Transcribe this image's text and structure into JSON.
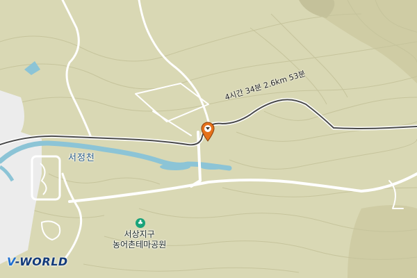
{
  "map": {
    "colors": {
      "land": "#d9d8b4",
      "contour": "#c6c49c",
      "water": "#8cc4d6",
      "road": "#ffffff",
      "route": "#4a4a4a",
      "urban": "#ececec",
      "pin": "#e5711b",
      "park_icon": "#1aa37a"
    },
    "labels": {
      "river": "서정천",
      "park_line1": "서상지구",
      "park_line2": "농어촌테마공원",
      "route_info": "4시간 34분 2.6km 53분"
    },
    "pin_icon": "location-pin-icon",
    "park_icon_name": "park-icon",
    "logo": {
      "prefix": "V",
      "suffix": "-WORLD"
    }
  }
}
